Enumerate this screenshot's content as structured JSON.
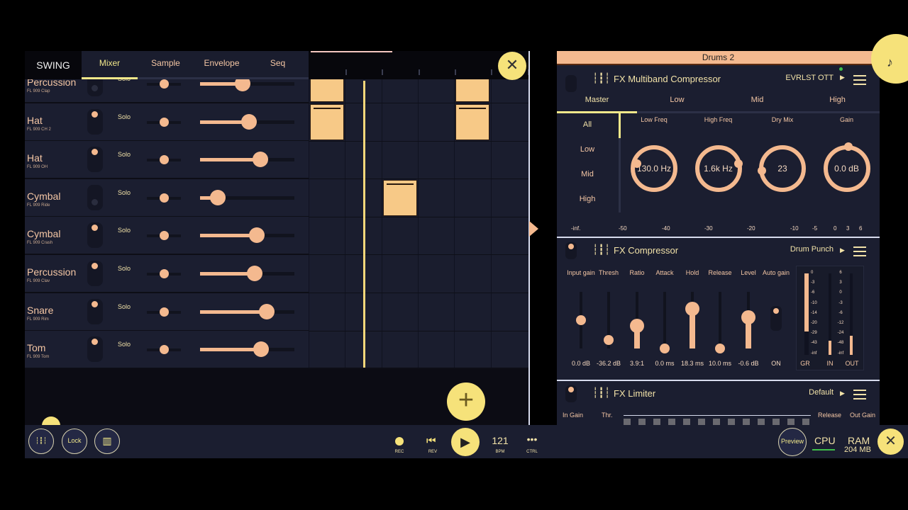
{
  "left_panel": {
    "swing_label": "SWING",
    "tabs": [
      {
        "label": "Mixer",
        "active": true
      },
      {
        "label": "Sample",
        "active": false
      },
      {
        "label": "Envelope",
        "active": false
      },
      {
        "label": "Seq",
        "active": false
      }
    ],
    "solo_label": "Solo",
    "channels": [
      {
        "name": "Percussion",
        "sample": "FL 909 Clap",
        "muted": true,
        "pan": 0.5,
        "volume": 0.45
      },
      {
        "name": "Hat",
        "sample": "FL 909 CH 2",
        "muted": false,
        "pan": 0.5,
        "volume": 0.52
      },
      {
        "name": "Hat",
        "sample": "FL 909 OH",
        "muted": false,
        "pan": 0.5,
        "volume": 0.64
      },
      {
        "name": "Cymbal",
        "sample": "FL 909 Ride",
        "muted": true,
        "pan": 0.5,
        "volume": 0.19
      },
      {
        "name": "Cymbal",
        "sample": "FL 909 Crash",
        "muted": false,
        "pan": 0.5,
        "volume": 0.6
      },
      {
        "name": "Percussion",
        "sample": "FL 909 Clav",
        "muted": false,
        "pan": 0.5,
        "volume": 0.58
      },
      {
        "name": "Snare",
        "sample": "FL 909 Rim",
        "muted": false,
        "pan": 0.5,
        "volume": 0.71
      },
      {
        "name": "Tom",
        "sample": "FL 909 Tom",
        "muted": false,
        "pan": 0.5,
        "volume": 0.65
      }
    ],
    "notes": [
      {
        "row": 0,
        "step": 0
      },
      {
        "row": 1,
        "step": 0
      },
      {
        "row": 0,
        "step": 4
      },
      {
        "row": 1,
        "step": 4
      },
      {
        "row": 3,
        "step": 2
      }
    ]
  },
  "transport": {
    "rec": "REC",
    "rev": "REV",
    "bpm": "121",
    "bpm_label": "BPM",
    "ctrl": "CTRL",
    "lock": "Lock",
    "preview": "Preview",
    "cpu": "CPU",
    "ram": "RAM",
    "ram_value": "204 MB"
  },
  "right_panel": {
    "channel_title": "Drums 2",
    "multiband": {
      "title": "FX Multiband Compressor",
      "preset": "EVRLST OTT",
      "band_tabs": [
        "Master",
        "Low",
        "Mid",
        "High"
      ],
      "side_items": [
        "All",
        "Low",
        "Mid",
        "High"
      ],
      "knobs": [
        {
          "label": "Low Freq",
          "value": "130.0 Hz"
        },
        {
          "label": "High Freq",
          "value": "1.6k Hz"
        },
        {
          "label": "Dry Mix",
          "value": "23"
        },
        {
          "label": "Gain",
          "value": "0.0 dB"
        }
      ],
      "scale": [
        "-inf.",
        "-50",
        "-40",
        "-30",
        "-20",
        "-10",
        "-5",
        "0",
        "3",
        "6"
      ]
    },
    "compressor": {
      "title": "FX Compressor",
      "preset": "Drum Punch",
      "params": [
        {
          "label": "Input gain",
          "value": "0.0 dB",
          "level": 0.5
        },
        {
          "label": "Thresh",
          "value": "-36.2 dB",
          "level": 0.15
        },
        {
          "label": "Ratio",
          "value": "3.9:1",
          "level": 0.4
        },
        {
          "label": "Attack",
          "value": "0.0 ms",
          "level": 0.0
        },
        {
          "label": "Hold",
          "value": "18.3 ms",
          "level": 0.7
        },
        {
          "label": "Release",
          "value": "10.0 ms",
          "level": 0.0
        },
        {
          "label": "Level",
          "value": "-0.6 dB",
          "level": 0.55
        },
        {
          "label": "Auto gain",
          "value": "ON"
        }
      ],
      "gr_scale": [
        "0",
        "-3",
        "-6",
        "-10",
        "-14",
        "-20",
        "-29",
        "-43",
        "-inf"
      ],
      "io_scale": [
        "6",
        "3",
        "0",
        "-3",
        "-6",
        "-12",
        "-24",
        "-48",
        "-inf"
      ],
      "meter_labels": [
        "GR",
        "IN",
        "OUT"
      ]
    },
    "limiter": {
      "title": "FX Limiter",
      "preset": "Default",
      "labels": [
        "In Gain",
        "Thr.",
        "Release",
        "Out Gain"
      ]
    }
  },
  "colors": {
    "accent": "#f4b98f",
    "highlight": "#f6e27a",
    "background": "#1b1e30"
  }
}
